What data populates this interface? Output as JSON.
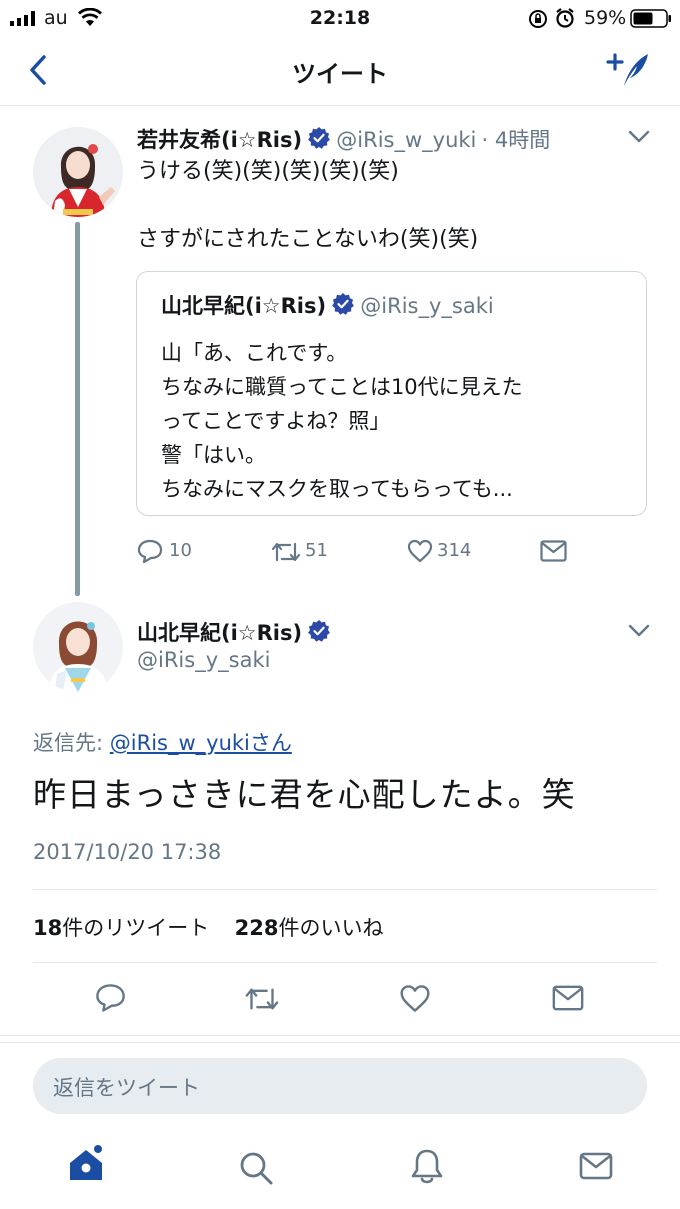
{
  "status_bar": {
    "carrier": "au",
    "time": "22:18",
    "battery": "59%"
  },
  "nav": {
    "title": "ツイート"
  },
  "parent_tweet": {
    "name": "若井友希(i☆Ris)",
    "handle": "@iRis_w_yuki",
    "time": "· 4時間",
    "text": "うける(笑)(笑)(笑)(笑)(笑)\n\nさすがにされたことないわ(笑)(笑)",
    "quote": {
      "name": "山北早紀(i☆Ris)",
      "handle": "@iRis_y_saki",
      "text": "山「あ、これです。\nちなみに職質ってことは10代に見えた\nってことですよね？照」\n警「はい。\nちなみにマスクを取ってもらっても..."
    },
    "actions": {
      "replies": "10",
      "retweets": "51",
      "likes": "314"
    }
  },
  "main_tweet": {
    "name": "山北早紀(i☆Ris)",
    "handle": "@iRis_y_saki",
    "reply_prefix": "返信先: ",
    "reply_target": "@iRis_w_yukiさん",
    "text": "昨日まっさきに君を心配したよ。笑",
    "timestamp": "2017/10/20 17:38",
    "retweet_count": "18",
    "retweet_label": "件のリツイート",
    "like_count": "228",
    "like_label": "件のいいね"
  },
  "reply_box": {
    "placeholder": "返信をツイート"
  },
  "colors": {
    "accent": "#1b4ea3",
    "verified": "#2b4aa8",
    "secondary_text": "#657786",
    "border": "#e1e8ed"
  }
}
